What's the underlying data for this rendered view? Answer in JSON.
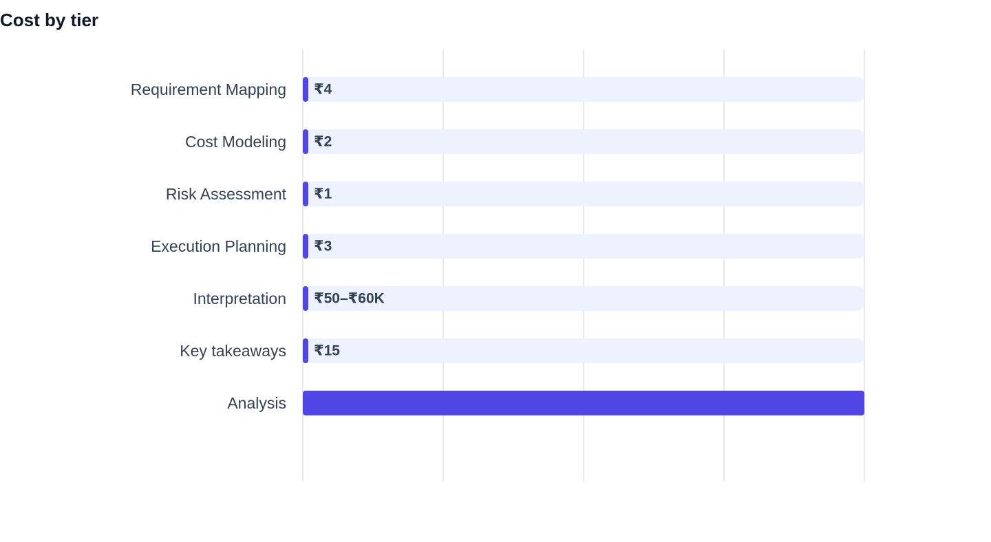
{
  "chart_data": {
    "type": "bar",
    "orientation": "horizontal",
    "title": "Cost by tier",
    "xlabel": "",
    "ylabel": "",
    "grid": true,
    "categories": [
      "Requirement Mapping",
      "Cost Modeling",
      "Risk Assessment",
      "Execution Planning",
      "Interpretation",
      "Key takeaways",
      "Analysis"
    ],
    "values": [
      4,
      2,
      1,
      3,
      0,
      15,
      60000
    ],
    "data_labels": [
      "₹4",
      "₹2",
      "₹1",
      "₹3",
      "₹50–₹60K",
      "₹15",
      ""
    ],
    "xlim": [
      0,
      60000
    ],
    "colors": {
      "bar": "#4f46e5",
      "track": "#eef2ff",
      "grid": "#e5e7eb",
      "label": "#334155",
      "title": "#111827"
    }
  }
}
